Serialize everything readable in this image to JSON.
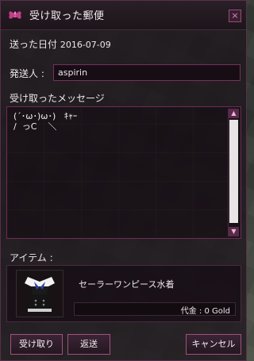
{
  "window": {
    "title": "受け取った郵便",
    "close_label": "×"
  },
  "sent_date": {
    "label": "送った日付",
    "value": "2016-07-09"
  },
  "sender": {
    "label": "発送人 :",
    "value": "aspirin"
  },
  "message": {
    "label": "受け取ったメッセージ",
    "line1": "(´･ω･)ω･)   ｷｬｰ",
    "line2": "/  っC    ＼"
  },
  "item": {
    "label": "アイテム :",
    "name": "セーラーワンピース水着",
    "price_label": "代金 : 0 Gold",
    "icon": "sailor-swimsuit-icon"
  },
  "buttons": {
    "receive": "受け取り",
    "return": "返送",
    "cancel": "キャンセル"
  },
  "colors": {
    "accent": "#a0517f",
    "border": "#7a2f5e",
    "panel": "#1e161c"
  }
}
